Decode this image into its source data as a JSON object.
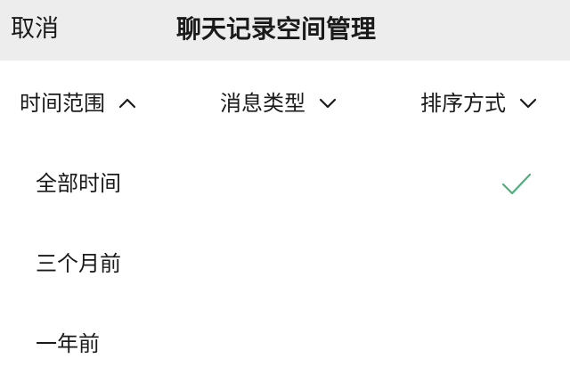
{
  "header": {
    "cancel_label": "取消",
    "title": "聊天记录空间管理"
  },
  "filters": [
    {
      "label": "时间范围",
      "icon": "chevron-up-icon",
      "expanded": true
    },
    {
      "label": "消息类型",
      "icon": "chevron-down-icon",
      "expanded": false
    },
    {
      "label": "排序方式",
      "icon": "chevron-down-icon",
      "expanded": false
    }
  ],
  "time_options": [
    {
      "label": "全部时间",
      "selected": true
    },
    {
      "label": "三个月前",
      "selected": false
    },
    {
      "label": "一年前",
      "selected": false
    }
  ],
  "colors": {
    "header_bg": "#ededed",
    "check": "#4caf7d",
    "text": "#1a1a1a"
  },
  "icons": {
    "selected": "check-icon"
  }
}
